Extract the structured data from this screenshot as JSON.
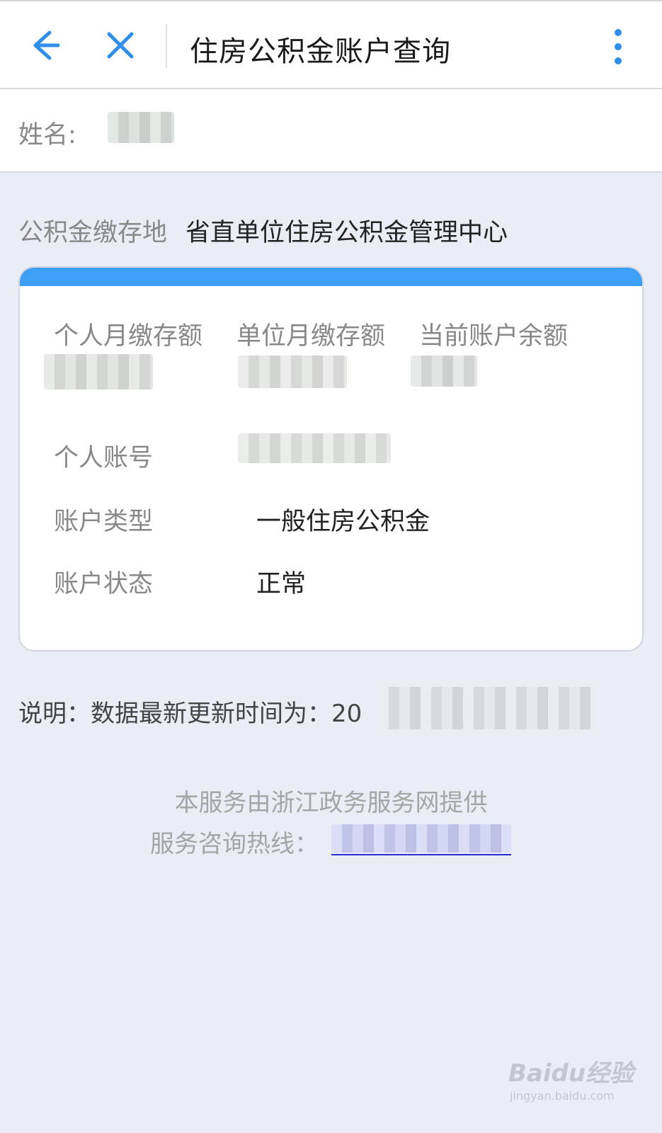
{
  "header": {
    "title": "住房公积金账户查询",
    "back_icon": "arrow-left-icon",
    "close_icon": "close-icon",
    "more_icon": "more-vertical-icon"
  },
  "name_row": {
    "label": "姓名:"
  },
  "deposit_place": {
    "label": "公积金缴存地",
    "value": "省直单位住房公积金管理中心"
  },
  "account_card": {
    "accent_color": "#3d9ff5",
    "stats": [
      {
        "label": "个人月缴存额"
      },
      {
        "label": "单位月缴存额"
      },
      {
        "label": "当前账户余额"
      }
    ],
    "rows": [
      {
        "label": "个人账号",
        "value": ""
      },
      {
        "label": "账户类型",
        "value": "一般住房公积金"
      },
      {
        "label": "账户状态",
        "value": "正常"
      }
    ]
  },
  "note": {
    "text": "说明：数据最新更新时间为：20"
  },
  "footer": {
    "provider": "本服务由浙江政务服务网提供",
    "hotline_label": "服务咨询热线：",
    "hotline_link_color": "#2b2fd1"
  },
  "watermark": {
    "logo": "Baidu经验",
    "url": "jingyan.baidu.com"
  }
}
